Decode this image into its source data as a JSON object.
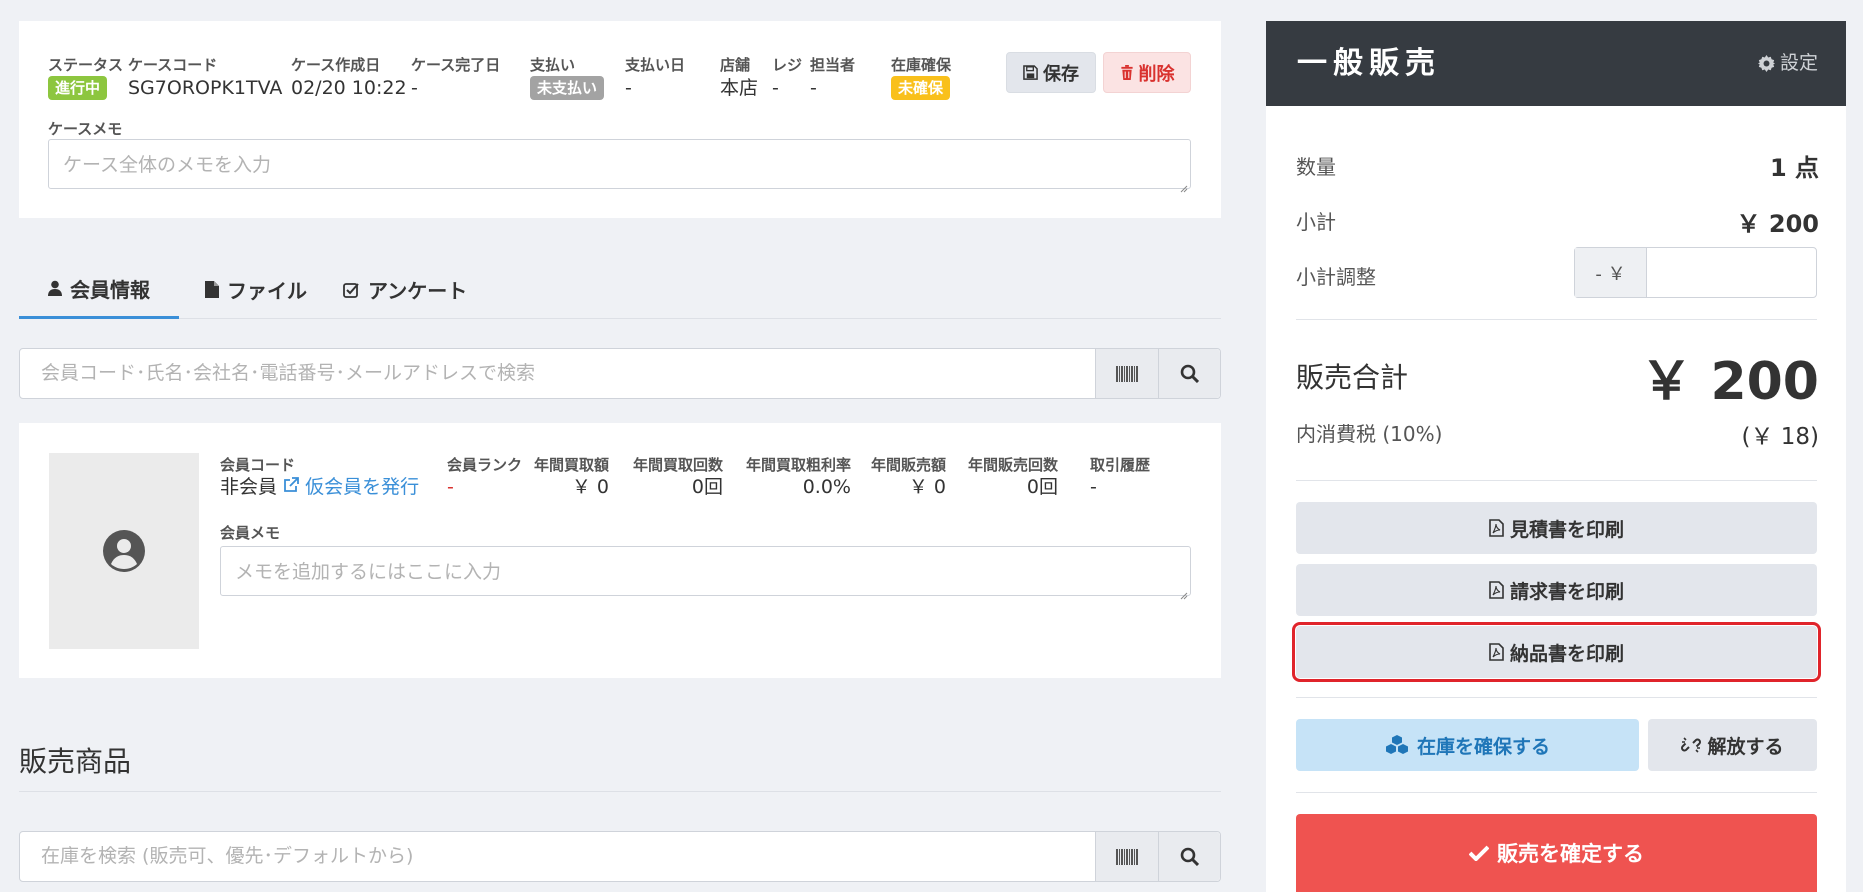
{
  "case": {
    "status_label": "ステータス",
    "status_value": "進行中",
    "code_label": "ケースコード",
    "code_value": "SG7OROPK1TVA",
    "created_label": "ケース作成日",
    "created_value": "02/20 10:22",
    "completed_label": "ケース完了日",
    "completed_value": "-",
    "payment_label": "支払い",
    "payment_value": "未支払い",
    "paydate_label": "支払い日",
    "paydate_value": "-",
    "store_label": "店舗",
    "store_value": "本店",
    "register_label": "レジ",
    "register_value": "-",
    "staff_label": "担当者",
    "staff_value": "-",
    "stock_label": "在庫確保",
    "stock_value": "未確保",
    "save_label": "保存",
    "delete_label": "削除",
    "memo_label": "ケースメモ",
    "memo_placeholder": "ケース全体のメモを入力"
  },
  "tabs": [
    {
      "label": "会員情報",
      "icon": "user-icon"
    },
    {
      "label": "ファイル",
      "icon": "file-icon"
    },
    {
      "label": "アンケート",
      "icon": "checkbox-icon"
    }
  ],
  "member_search": {
    "placeholder": "会員コード･氏名･会社名･電話番号･メールアドレスで検索"
  },
  "member": {
    "code_label": "会員コード",
    "code_value": "非会員",
    "issue_link": "仮会員を発行",
    "rank_label": "会員ランク",
    "rank_value": "-",
    "annual_buy_amount_label": "年間買取額",
    "annual_buy_amount_value": "￥ 0",
    "annual_buy_count_label": "年間買取回数",
    "annual_buy_count_value": "0回",
    "annual_margin_label": "年間買取粗利率",
    "annual_margin_value": "0.0%",
    "annual_sales_amount_label": "年間販売額",
    "annual_sales_amount_value": "￥ 0",
    "annual_sales_count_label": "年間販売回数",
    "annual_sales_count_value": "0回",
    "history_label": "取引履歴",
    "history_value": "-",
    "memo_label": "会員メモ",
    "memo_placeholder": "メモを追加するにはここに入力"
  },
  "products": {
    "title": "販売商品",
    "search_placeholder": "在庫を検索 (販売可、優先･デフォルトから)"
  },
  "panel": {
    "title": "一般販売",
    "settings_label": "設定",
    "qty_label": "数量",
    "qty_value": "1 点",
    "subtotal_label": "小計",
    "subtotal_value": "￥ 200",
    "adjust_label": "小計調整",
    "adjust_prefix": "- ￥",
    "adjust_value": "",
    "total_label": "販売合計",
    "total_value": "￥ 200",
    "tax_label": "内消費税 (10%)",
    "tax_value": "(￥ 18)",
    "estimate_btn": "見積書を印刷",
    "invoice_btn": "請求書を印刷",
    "delivery_btn": "納品書を印刷",
    "reserve_btn": "在庫を確保する",
    "release_btn": "解放する",
    "confirm_btn": "販売を確定する"
  },
  "colors": {
    "accent": "#3a8fd8",
    "header_dark": "#363b41",
    "confirm_red": "#ef5350",
    "status_green": "#8dc63f",
    "stock_yellow": "#f9c01b",
    "highlight": "#e0242b"
  }
}
